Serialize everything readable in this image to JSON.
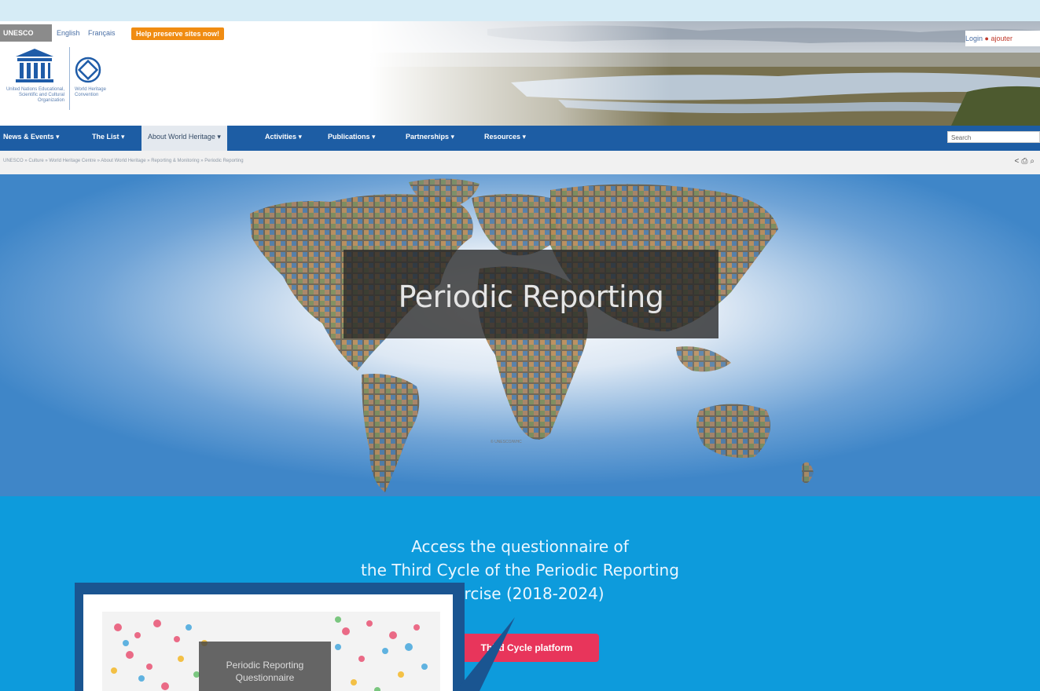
{
  "header": {
    "unesco_tag": "UNESCO",
    "lang_english": "English",
    "lang_french": "Français",
    "help_button": "Help preserve sites now!",
    "logo_left_caption": "United Nations Educational, Scientific and Cultural Organization",
    "logo_right_caption": "World Heritage Convention",
    "login": "Login",
    "my_link": "ajouter"
  },
  "nav": {
    "items": [
      {
        "label": "News & Events ▾"
      },
      {
        "label": "The List ▾"
      },
      {
        "label": "About World Heritage ▾"
      },
      {
        "label": "Activities ▾"
      },
      {
        "label": "Publications ▾"
      },
      {
        "label": "Partnerships ▾"
      },
      {
        "label": "Resources ▾"
      }
    ],
    "search_placeholder": "Search"
  },
  "breadcrumb": "UNESCO » Culture » World Heritage Centre » About World Heritage » Reporting & Monitoring » Periodic Reporting",
  "tools_icons": [
    "share-icon",
    "print-icon",
    "search-icon"
  ],
  "hero": {
    "title": "Periodic Reporting",
    "credit": "© UNESCO/WHC"
  },
  "access": {
    "line1": "Access the questionnaire of",
    "line2": "the Third Cycle of the Periodic Reporting",
    "line3": "Exercise (2018-2024)"
  },
  "platform_button": "Third Cycle platform",
  "thumbnail": {
    "title_line1": "Periodic Reporting",
    "title_line2": "Questionnaire"
  },
  "colors": {
    "nav": "#1d5da4",
    "hero_blue": "#3f86c8",
    "lower_blue": "#0d9bdc",
    "button_pink": "#e8355b",
    "help_orange": "#f08c12"
  }
}
